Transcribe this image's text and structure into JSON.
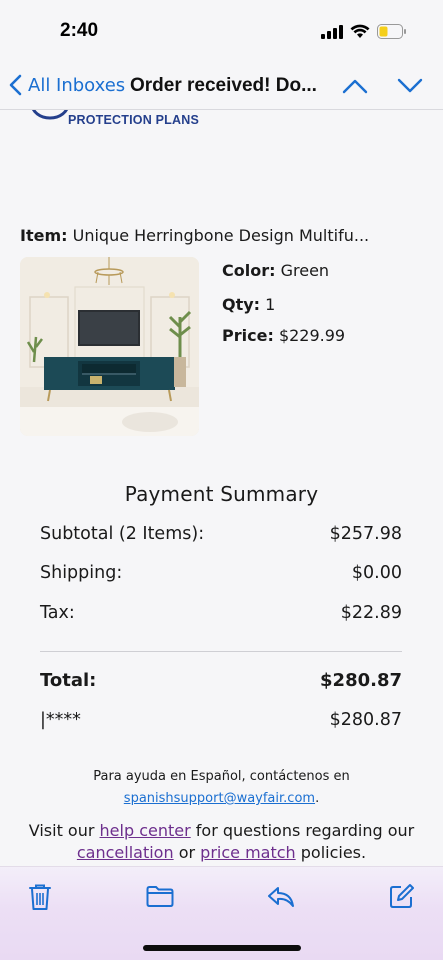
{
  "status_bar": {
    "time": "2:40"
  },
  "nav": {
    "back_label": "All Inboxes",
    "title": "Order received! Do..."
  },
  "email": {
    "protection_plans_text": "PROTECTION PLANS",
    "item": {
      "label": "Item:",
      "name": "Unique Herringbone Design Multifu...",
      "color_label": "Color:",
      "color_value": "Green",
      "qty_label": "Qty:",
      "qty_value": "1",
      "price_label": "Price:",
      "price_value": "$229.99"
    },
    "payment_summary": {
      "title": "Payment Summary",
      "subtotal_label": "Subtotal (2 Items):",
      "subtotal_value": "$257.98",
      "shipping_label": "Shipping:",
      "shipping_value": "$0.00",
      "tax_label": "Tax:",
      "tax_value": "$22.89",
      "total_label": "Total:",
      "total_value": "$280.87",
      "card_label": "|****",
      "card_value": "$280.87"
    },
    "help_es_text": "Para ayuda en Español, contáctenos en",
    "help_es_email": "spanishsupport@wayfair.com",
    "help_es_period": ".",
    "visit": {
      "prefix": "Visit our ",
      "help_center": "help center",
      "middle": " for questions regarding our",
      "cancellation": "cancellation",
      "or": " or ",
      "price_match": "price match",
      "suffix": " policies."
    }
  },
  "toolbar": {
    "icons": [
      "trash-icon",
      "folder-icon",
      "reply-icon",
      "compose-icon"
    ]
  },
  "colors": {
    "accent_blue": "#1b6fd1",
    "link_purple": "#6d2f8d",
    "protection_navy": "#243f8c"
  }
}
